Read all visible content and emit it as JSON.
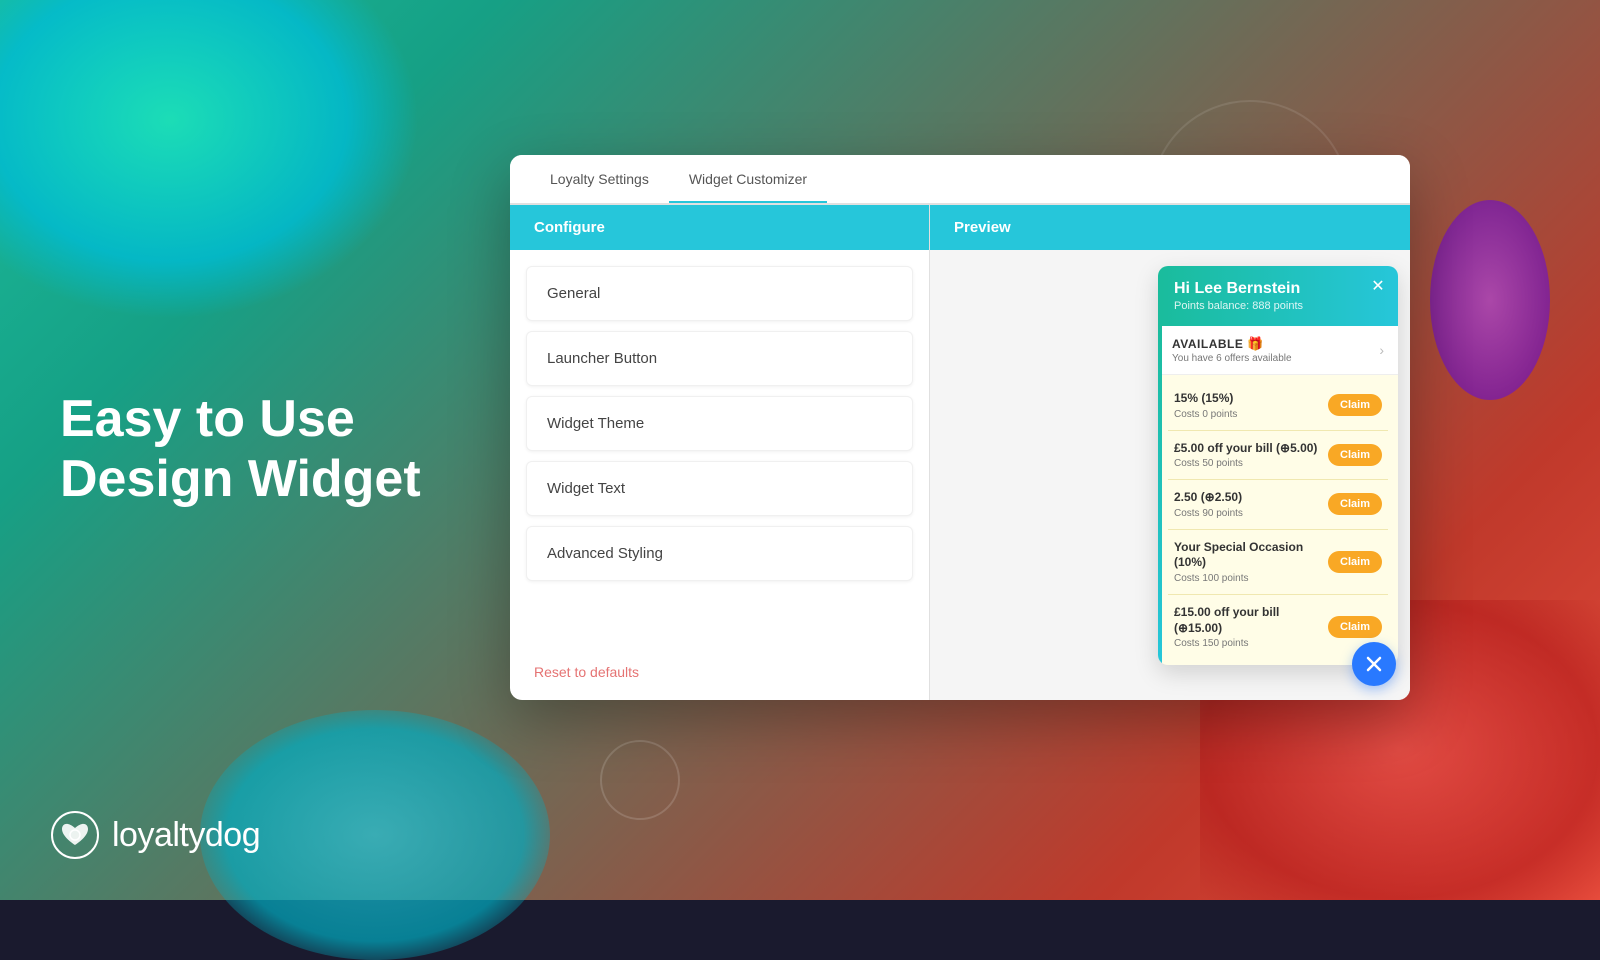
{
  "background": {
    "colors": {
      "teal": "#1abc9c",
      "red": "#e74c3c",
      "purple": "#ab47bc"
    }
  },
  "hero": {
    "line1": "Easy to Use",
    "line2": "Design Widget"
  },
  "logo": {
    "text": "loyaltydog"
  },
  "tabs": {
    "tab1": "Loyalty Settings",
    "tab2": "Widget Customizer"
  },
  "config": {
    "header": "Configure",
    "menu_items": [
      "General",
      "Launcher Button",
      "Widget Theme",
      "Widget Text",
      "Advanced Styling"
    ],
    "reset_label": "Reset to defaults"
  },
  "preview": {
    "header": "Preview",
    "widget": {
      "greeting": "Hi Lee Bernstein",
      "points_label": "Points balance: 888 points",
      "available_title": "AVAILABLE",
      "available_sub": "You have 6 offers available",
      "offers": [
        {
          "title": "15% (15%)",
          "cost": "Costs 0 points",
          "btn": "Claim"
        },
        {
          "title": "£5.00 off your bill (⊕5.00)",
          "cost": "Costs 50 points",
          "btn": "Claim"
        },
        {
          "title": "2.50 (⊕2.50)",
          "cost": "Costs 90 points",
          "btn": "Claim"
        },
        {
          "title": "Your Special Occasion (10%)",
          "cost": "Costs 100 points",
          "btn": "Claim"
        },
        {
          "title": "£15.00 off your bill (⊕15.00)",
          "cost": "Costs 150 points",
          "btn": "Claim"
        }
      ]
    }
  }
}
